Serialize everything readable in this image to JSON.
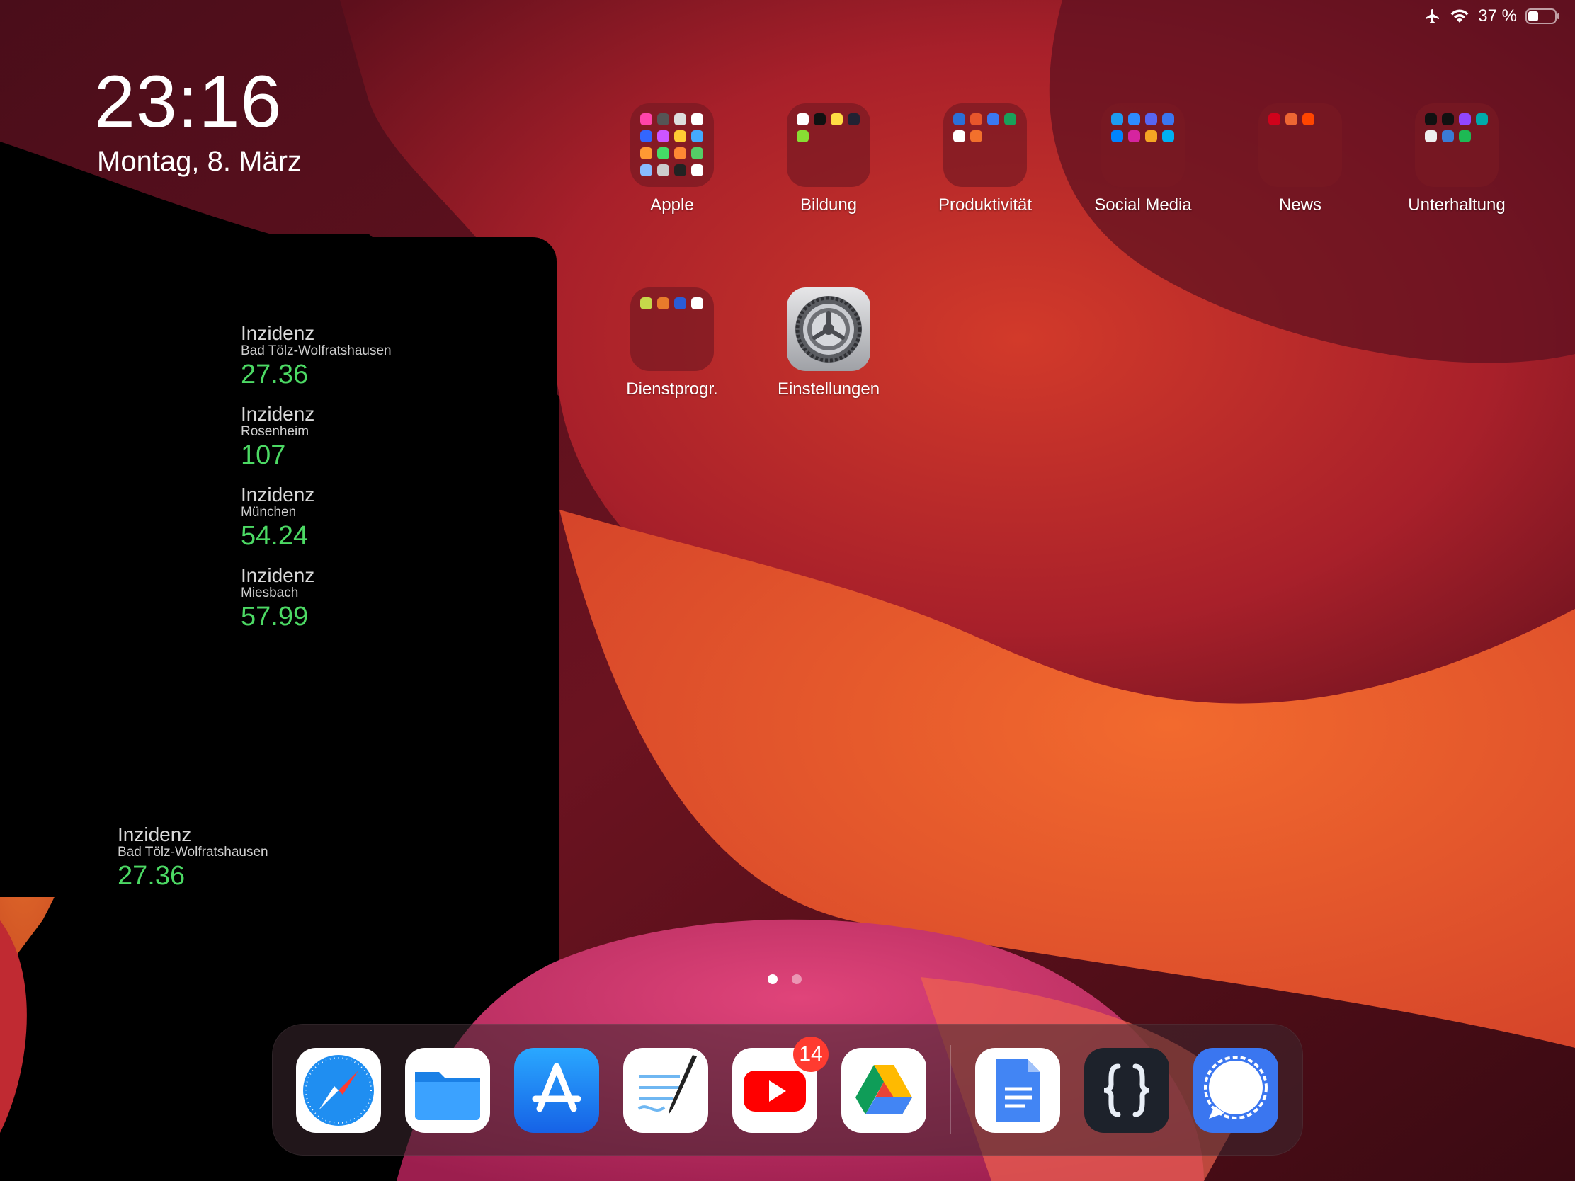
{
  "status": {
    "battery_text": "37 %",
    "icons": [
      "airplane-icon",
      "wifi-icon",
      "battery-icon"
    ]
  },
  "lockclock": {
    "time": "23:16",
    "date": "Montag, 8. März"
  },
  "widgets": [
    {
      "title": "Inzidenz",
      "place": "Bad Tölz-Wolfratshausen",
      "value": "27.36"
    },
    {
      "title": "Inzidenz",
      "place": "Rosenheim",
      "value": "107"
    },
    {
      "title": "Inzidenz",
      "place": "München",
      "value": "54.24"
    },
    {
      "title": "Inzidenz",
      "place": "Miesbach",
      "value": "57.99"
    },
    {
      "title": "Inzidenz",
      "place": "Bad Tölz-Wolfratshausen",
      "value": "27.36"
    }
  ],
  "apps": [
    {
      "label": "Apple"
    },
    {
      "label": "Bildung"
    },
    {
      "label": "Produktivität"
    },
    {
      "label": "Social Media"
    },
    {
      "label": "News"
    },
    {
      "label": "Unterhaltung"
    },
    {
      "label": "Dienstprogr."
    },
    {
      "label": "Einstellungen"
    }
  ],
  "dock": {
    "youtube_badge": "14",
    "apps": [
      "safari-icon",
      "files-icon",
      "app-store-icon",
      "goodnotes-icon",
      "youtube-icon",
      "google-drive-icon",
      "google-docs-icon",
      "json-editor-icon",
      "signal-icon"
    ]
  },
  "page_indicator": {
    "pages": 2,
    "current": 1
  },
  "colors": {
    "incidence_value": "#4cd964",
    "badge": "#ff3b30"
  }
}
